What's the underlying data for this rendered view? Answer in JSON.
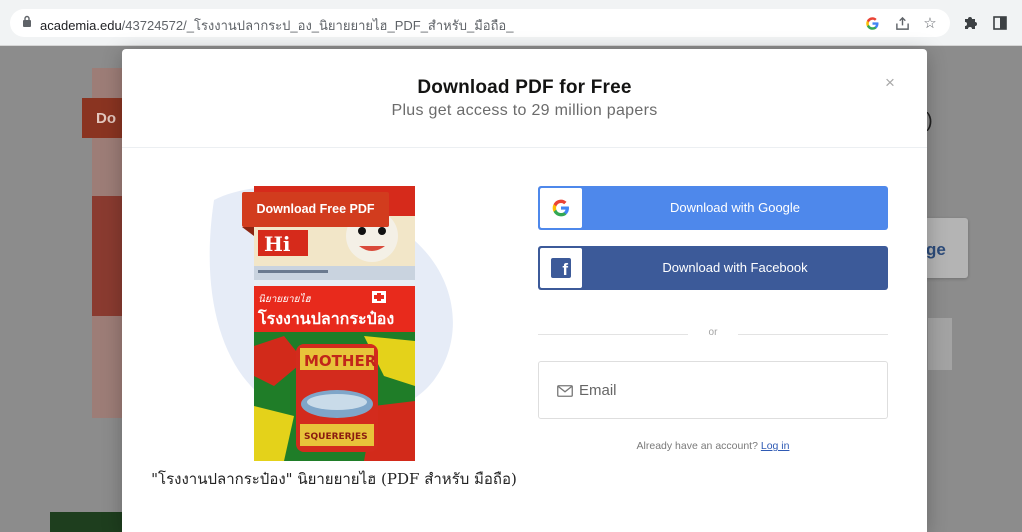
{
  "browser": {
    "url_domain": "academia.edu",
    "url_path": "/43724572/_โรงงานปลากระป_อง_นิยายยายไฮ_PDF_สำหรับ_มือถือ_",
    "icons": [
      "lock-icon",
      "google-icon",
      "share-icon",
      "star-icon",
      "puzzle-icon",
      "sidepanel-icon"
    ]
  },
  "background": {
    "tag_text": "Do",
    "card_text": "ge",
    "paren_text": ")"
  },
  "modal": {
    "title": "Download PDF for Free",
    "subtitle": "Plus get access to 29 million papers",
    "close_glyph": "×",
    "cover": {
      "badge": "Download Free PDF",
      "caption": "\"โรงงานปลากระป๋อง\" นิยายยายไฮ (PDF สำหรับ มือถือ)"
    },
    "google_button": "Download with Google",
    "facebook_button": "Download with Facebook",
    "divider": "or",
    "email_placeholder": "Email",
    "account_prompt": "Already have an account?",
    "login_link": "Log in",
    "colors": {
      "google": "#4e88eb",
      "facebook": "#3c5a99",
      "badge": "#d23c1e",
      "link": "#2f5ab4"
    }
  }
}
